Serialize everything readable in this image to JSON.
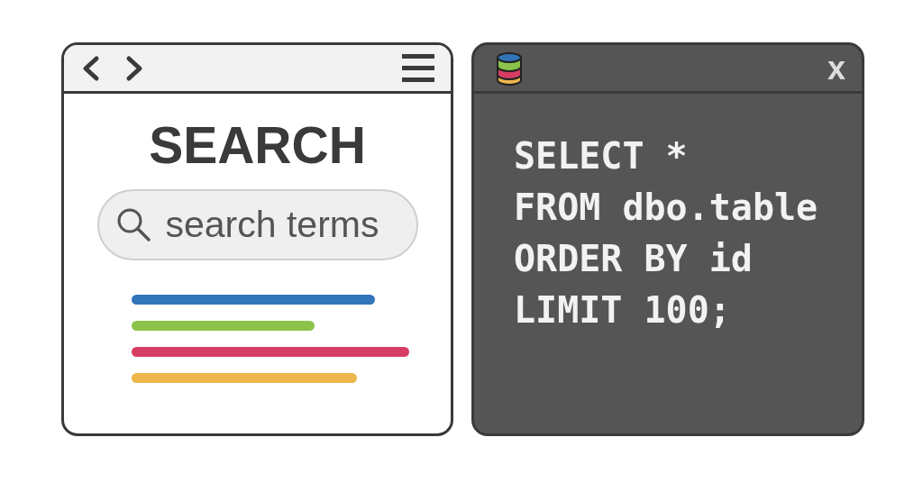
{
  "browser_window": {
    "heading": "SEARCH",
    "search": {
      "placeholder": "search terms"
    },
    "results": [
      {
        "color": "#3274b8"
      },
      {
        "color": "#8bc34a"
      },
      {
        "color": "#d63d63"
      },
      {
        "color": "#efb64c"
      }
    ]
  },
  "sql_window": {
    "close": "x",
    "code_lines": [
      "SELECT *",
      "FROM dbo.table",
      "ORDER BY id",
      "LIMIT 100;"
    ]
  }
}
